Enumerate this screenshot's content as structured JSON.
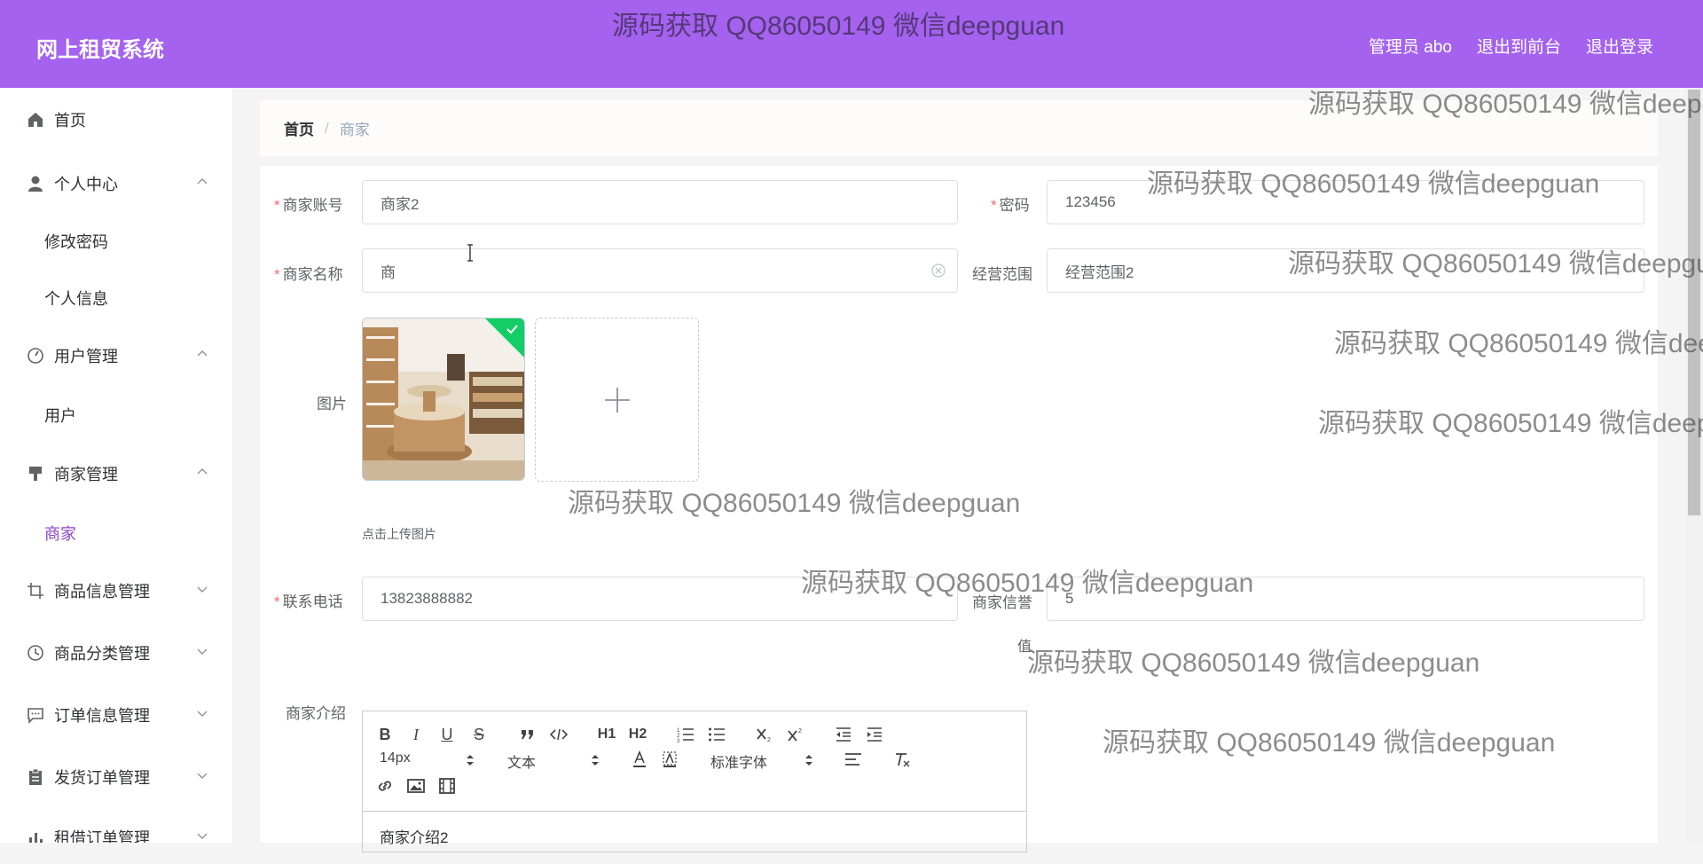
{
  "header": {
    "brand": "网上租贸系统",
    "nav": [
      "管理员 abo",
      "退出到前台",
      "退出登录"
    ]
  },
  "watermark": "源码获取 QQ86050149 微信deepguan",
  "sidebar": {
    "menu": [
      {
        "label": "首页",
        "icon": "home-icon"
      },
      {
        "label": "个人中心",
        "icon": "user-icon",
        "expanded": true
      },
      {
        "label": "用户管理",
        "icon": "dashboard-icon",
        "expanded": true
      },
      {
        "label": "商家管理",
        "icon": "brush-icon",
        "expanded": true
      },
      {
        "label": "商品信息管理",
        "icon": "crop-icon",
        "expanded": false
      },
      {
        "label": "商品分类管理",
        "icon": "clock-icon",
        "expanded": false
      },
      {
        "label": "订单信息管理",
        "icon": "message-icon",
        "expanded": false
      },
      {
        "label": "发货订单管理",
        "icon": "clipboard-icon",
        "expanded": false
      },
      {
        "label": "租借订单管理",
        "icon": "chart-icon",
        "expanded": false
      }
    ],
    "sub": [
      "修改密码",
      "个人信息",
      "用户",
      "商家"
    ]
  },
  "breadcrumb": {
    "home": "首页",
    "current": "商家"
  },
  "form": {
    "account": {
      "label": "商家账号",
      "value": "商家2"
    },
    "password": {
      "label": "密码",
      "value": "123456"
    },
    "name": {
      "label": "商家名称",
      "value": "商"
    },
    "scope": {
      "label": "经营范围",
      "value": "经营范围2"
    },
    "image": {
      "label": "图片",
      "tip": "点击上传图片"
    },
    "phone": {
      "label": "联系电话",
      "value": "13823888882"
    },
    "credit": {
      "label": "商家信誉",
      "label_wrap": "值",
      "value": "5"
    },
    "intro": {
      "label": "商家介绍",
      "value": "商家介绍2"
    }
  },
  "editor": {
    "font_size": "14px",
    "header_select": "文本",
    "font_family": "标准字体",
    "h1": "H1",
    "h2": "H2",
    "bold": "B",
    "italic": "I",
    "underline": "U",
    "strike": "S"
  },
  "colors": {
    "accent": "#a462ef",
    "active_menu": "#8e44c9",
    "required": "#f56c6c"
  }
}
